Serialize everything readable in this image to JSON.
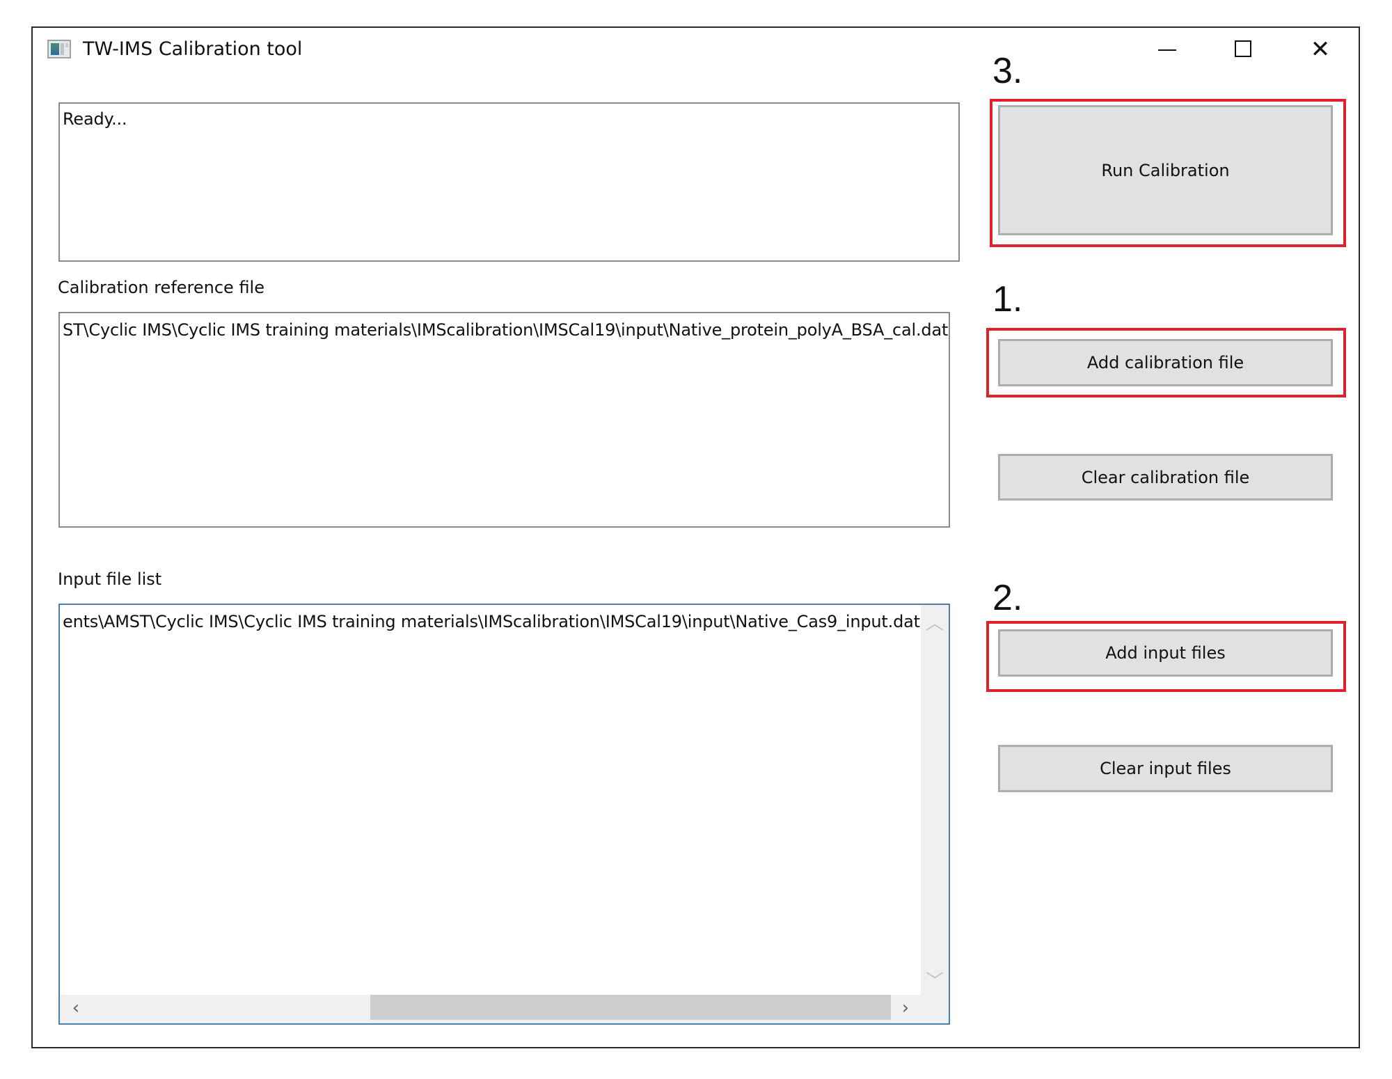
{
  "window": {
    "title": "TW-IMS Calibration tool",
    "controls": {
      "minimize_icon": "minimize-icon",
      "maximize_icon": "maximize-icon",
      "close_icon": "close-icon",
      "close_glyph": "✕"
    }
  },
  "status": {
    "text": "Ready..."
  },
  "calibration": {
    "label": "Calibration reference file",
    "path": "ST\\Cyclic IMS\\Cyclic IMS training materials\\IMScalibration\\IMSCal19\\input\\Native_protein_polyA_BSA_cal.dat"
  },
  "input_files": {
    "label": "Input file list",
    "items": [
      "ents\\AMST\\Cyclic IMS\\Cyclic IMS training materials\\IMScalibration\\IMSCal19\\input\\Native_Cas9_input.dat"
    ],
    "scroll_up": "^",
    "scroll_down": "v",
    "scroll_left": "<",
    "scroll_right": ">"
  },
  "steps": {
    "run": "3.",
    "add_calibration": "1.",
    "add_input": "2."
  },
  "buttons": {
    "run_calibration": "Run Calibration",
    "add_calibration_file": "Add calibration file",
    "clear_calibration_file": "Clear calibration file",
    "add_input_files": "Add input files",
    "clear_input_files": "Clear input files"
  },
  "colors": {
    "highlight": "#e0202a",
    "button_bg": "#e1e1e1",
    "list_border": "#4a7fae"
  }
}
